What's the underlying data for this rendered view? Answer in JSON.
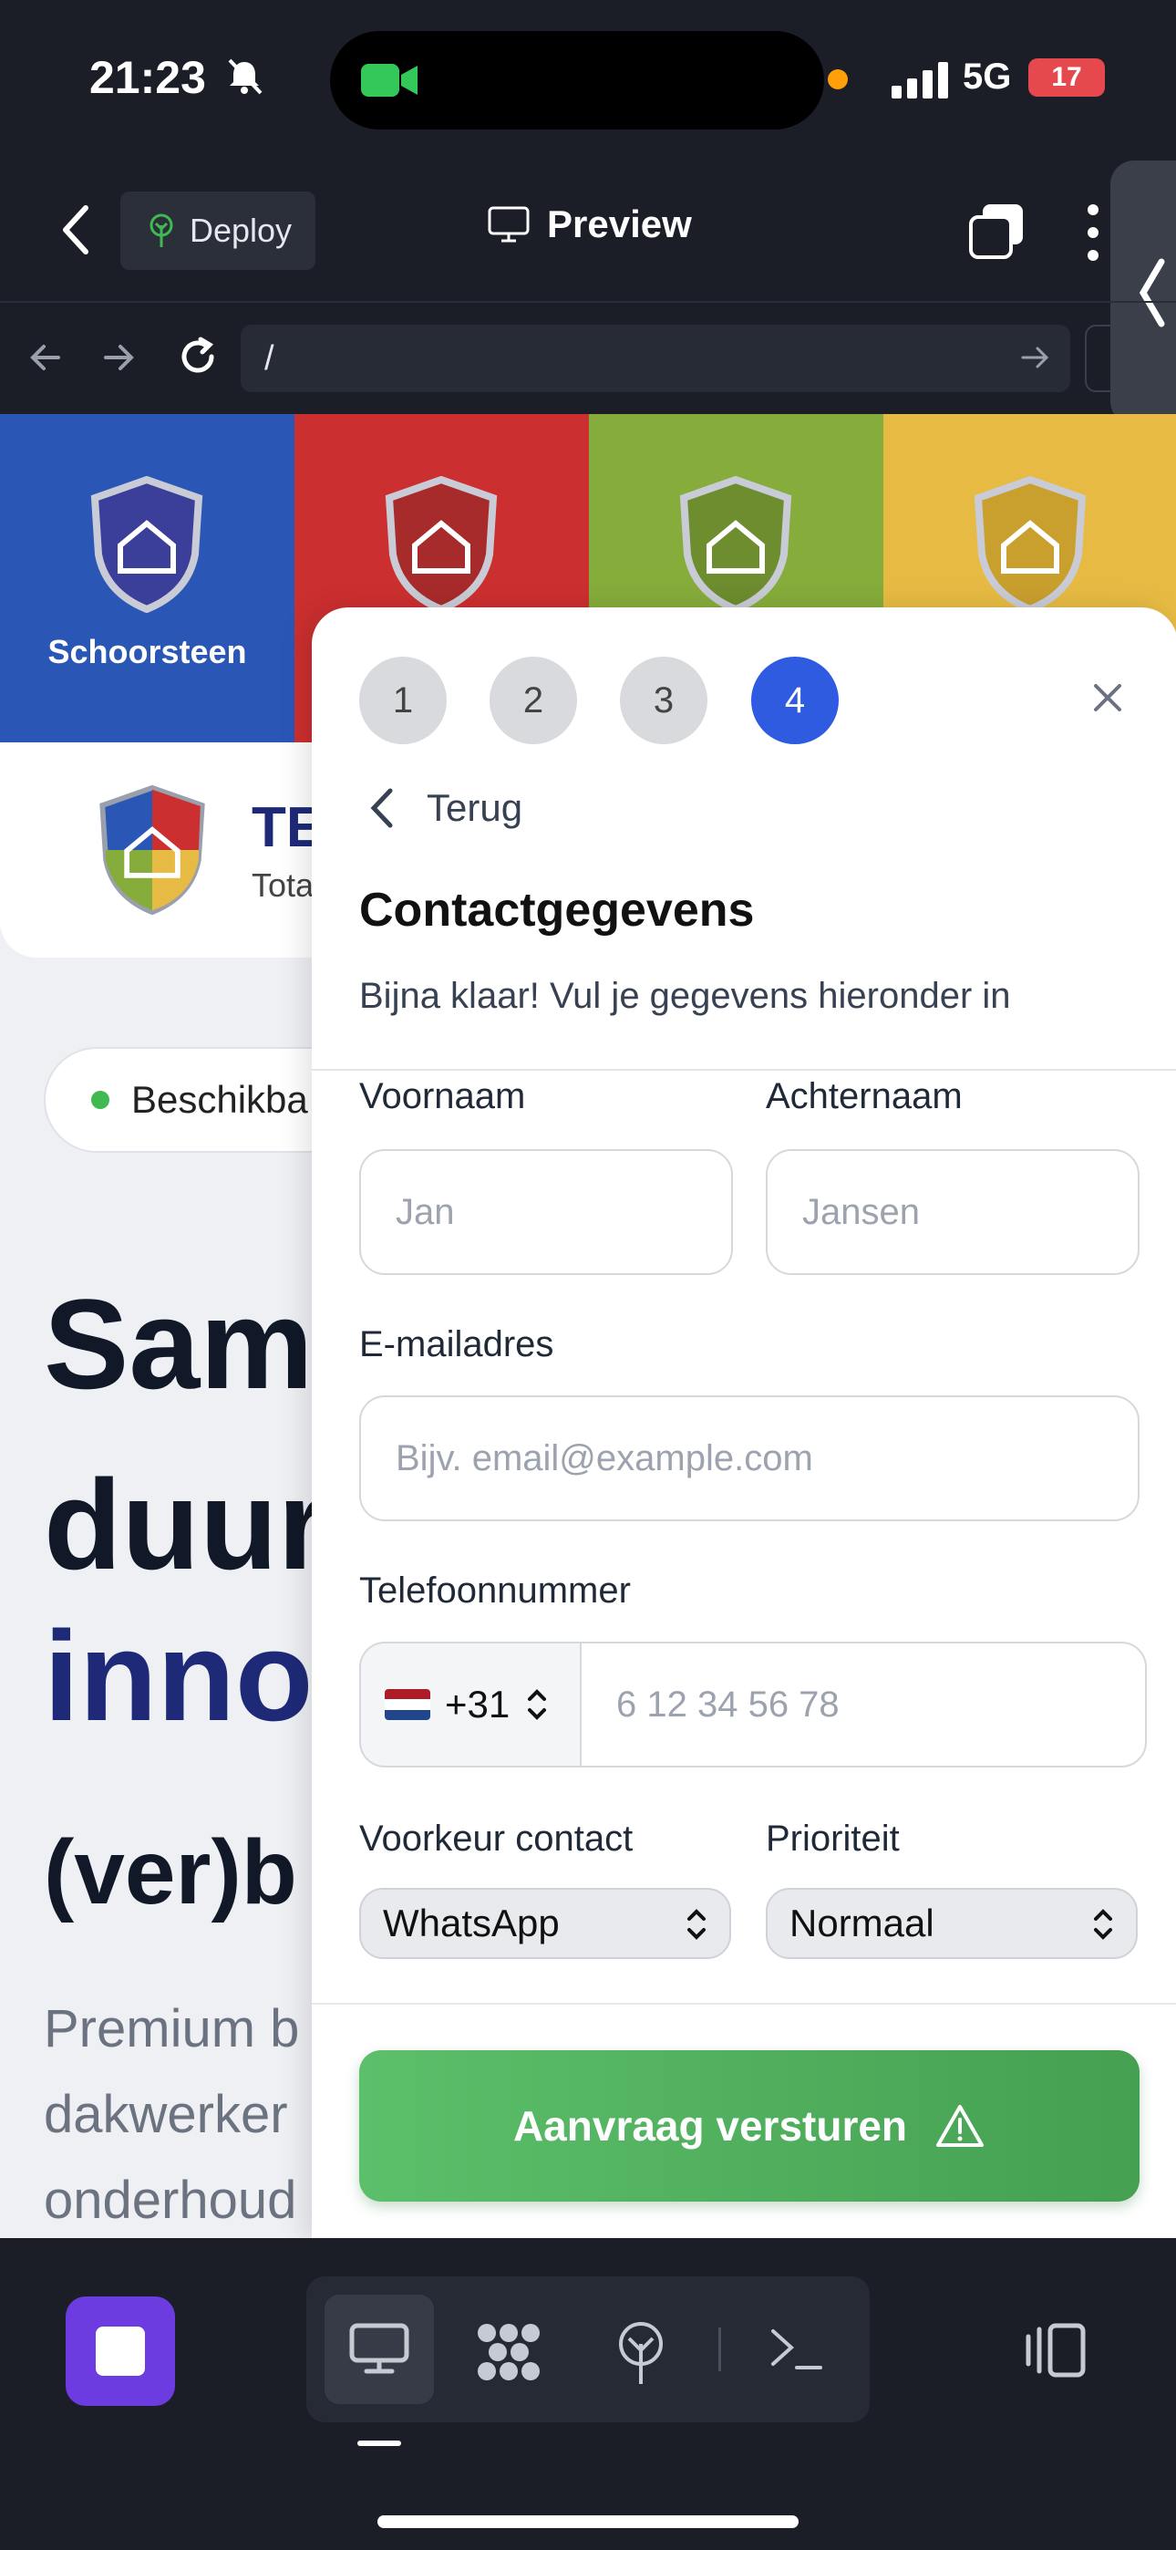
{
  "status_bar": {
    "time": "21:23",
    "network": "5G",
    "battery": "17"
  },
  "app_bar": {
    "deploy_label": "Deploy",
    "preview_label": "Preview",
    "url": "/"
  },
  "website": {
    "bands": [
      {
        "label": "Schoorsteen",
        "color": "#2a57b6"
      },
      {
        "label": "",
        "color": "#cc2f2f"
      },
      {
        "label": "",
        "color": "#86ad3b"
      },
      {
        "label": "",
        "color": "#e7bb43"
      }
    ],
    "brand_title": "TE",
    "brand_subtitle": "Tota",
    "availability": "Beschikba",
    "hero_lines": [
      "Sam",
      "duur",
      "inno"
    ],
    "hero_subtitle": "(ver)b",
    "paragraph_lines": [
      "Premium b",
      "dakwerker",
      "onderhoud"
    ]
  },
  "modal": {
    "steps": [
      "1",
      "2",
      "3",
      "4"
    ],
    "active_step": "4",
    "back_label": "Terug",
    "title": "Contactgegevens",
    "description": "Bijna klaar! Vul je gegevens hieronder in",
    "first_name": {
      "label": "Voornaam",
      "placeholder": "Jan"
    },
    "last_name": {
      "label": "Achternaam",
      "placeholder": "Jansen"
    },
    "email": {
      "label": "E-mailadres",
      "placeholder": "Bijv. email@example.com"
    },
    "phone": {
      "label": "Telefoonnummer",
      "country_code": "+31",
      "placeholder": "6 12 34 56 78"
    },
    "contact_pref": {
      "label": "Voorkeur contact",
      "value": "WhatsApp"
    },
    "priority": {
      "label": "Prioriteit",
      "value": "Normaal"
    },
    "submit_label": "Aanvraag versturen"
  },
  "colors": {
    "accent_blue": "#2f5be0",
    "submit_green": "#4caf5a",
    "app_purple": "#6d3ce0",
    "dark_bg": "#1b1e27"
  }
}
